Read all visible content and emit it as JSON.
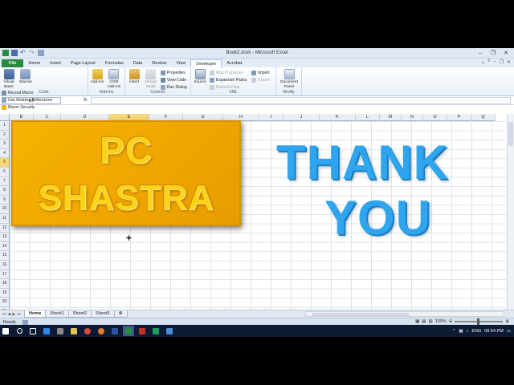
{
  "window": {
    "title": "Book2.xlsm - Microsoft Excel"
  },
  "ribbon_tabs": [
    "File",
    "Home",
    "Insert",
    "Page Layout",
    "Formulas",
    "Data",
    "Review",
    "View",
    "Developer",
    "Acrobat"
  ],
  "active_tab": "Developer",
  "groups": {
    "code": {
      "label": "Code",
      "visual_basic": "Visual Basic",
      "macros": "Macros",
      "record_macro": "Record Macro",
      "use_relative": "Use Relative References",
      "macro_security": "Macro Security"
    },
    "addins": {
      "label": "Add-Ins",
      "addins": "Add-Ins",
      "com_addins": "COM Add-Ins"
    },
    "controls": {
      "label": "Controls",
      "insert": "Insert",
      "design_mode": "Design Mode",
      "properties": "Properties",
      "view_code": "View Code",
      "run_dialog": "Run Dialog"
    },
    "xml": {
      "label": "XML",
      "source": "Source",
      "map_properties": "Map Properties",
      "expansion_packs": "Expansion Packs",
      "refresh_data": "Refresh Data",
      "import": "Import",
      "export": "Export"
    },
    "modify": {
      "label": "Modify",
      "document_panel": "Document Panel"
    }
  },
  "formula_bar": {
    "name_box": "E5",
    "fx": "fx",
    "value": ""
  },
  "columns": [
    "B",
    "C",
    "D",
    "E",
    "F",
    "G",
    "H",
    "I",
    "J",
    "K",
    "L",
    "M",
    "N",
    "O",
    "P",
    "Q"
  ],
  "selected_column": "E",
  "rows": [
    "1",
    "2",
    "3",
    "4",
    "5",
    "6",
    "7",
    "8",
    "9",
    "10",
    "11",
    "12",
    "13",
    "14",
    "15",
    "16",
    "17",
    "18",
    "19",
    "20",
    "21"
  ],
  "selected_row": "5",
  "art": {
    "pc_line1": "PC",
    "pc_line2": "SHASTRA",
    "thank": "THANK",
    "you": "YOU"
  },
  "sheets": [
    "Home",
    "Sheet1",
    "Sheet2",
    "Sheet3"
  ],
  "active_sheet": "Home",
  "status": {
    "ready": "Ready",
    "zoom": "100%"
  },
  "taskbar": {
    "language": "ENG",
    "time": "09:54 PM"
  },
  "colors": {
    "pc_box": "#f0a800",
    "thank_you_text": "#2fa4ef",
    "file_tab": "#2a8a3e",
    "taskbar": "#0c1a33"
  }
}
